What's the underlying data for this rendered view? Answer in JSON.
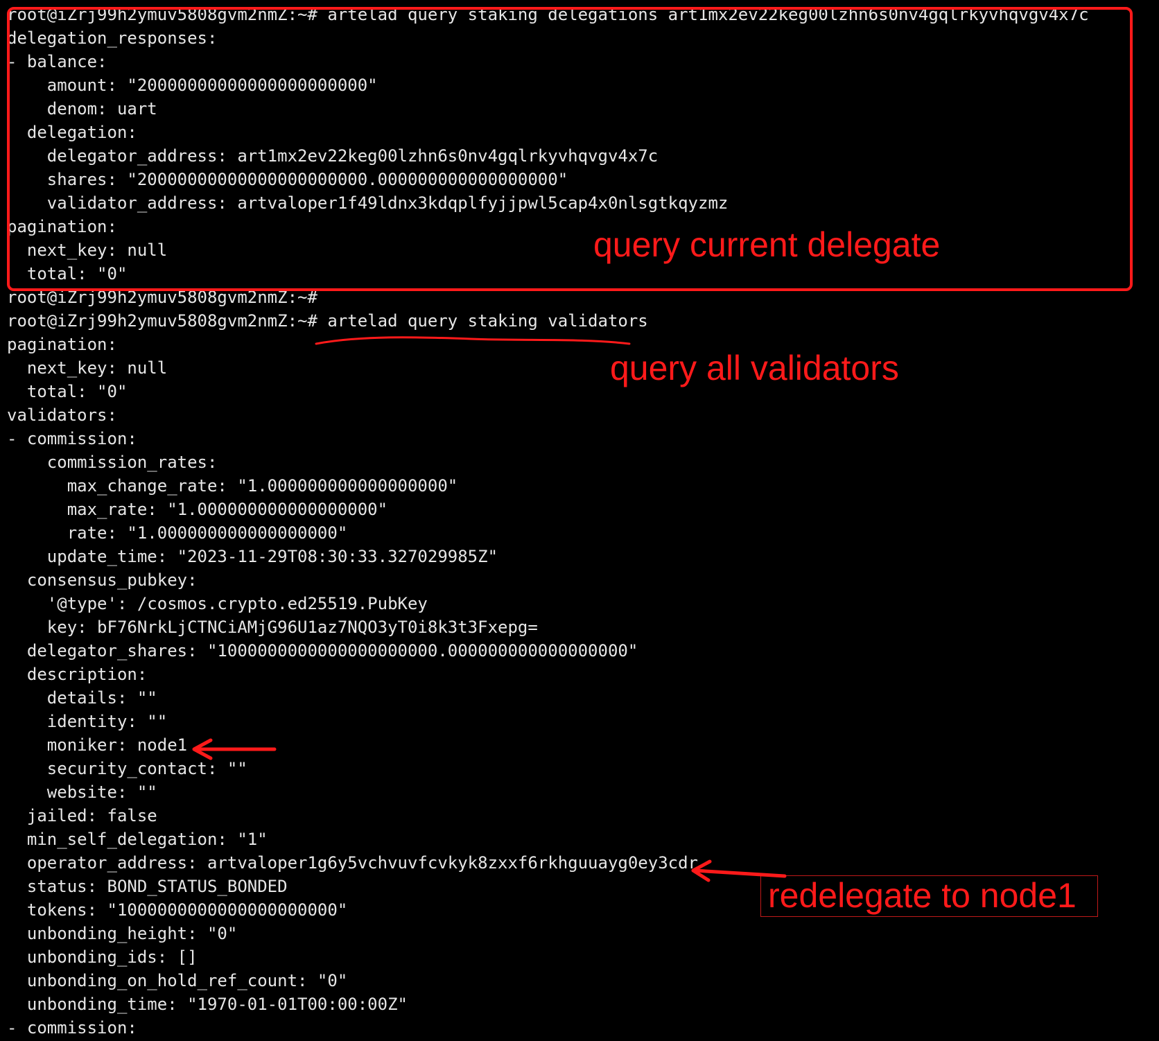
{
  "terminal": {
    "lines": [
      "root@iZrj99h2ymuv5808gvm2nmZ:~# artelad query staking delegations art1mx2ev22keg00lzhn6s0nv4gqlrkyvhqvgv4x7c",
      "delegation_responses:",
      "- balance:",
      "    amount: \"20000000000000000000000\"",
      "    denom: uart",
      "  delegation:",
      "    delegator_address: art1mx2ev22keg00lzhn6s0nv4gqlrkyvhqvgv4x7c",
      "    shares: \"20000000000000000000000.000000000000000000\"",
      "    validator_address: artvaloper1f49ldnx3kdqplfyjjpwl5cap4x0nlsgtkqyzmz",
      "pagination:",
      "  next_key: null",
      "  total: \"0\"",
      "root@iZrj99h2ymuv5808gvm2nmZ:~#",
      "root@iZrj99h2ymuv5808gvm2nmZ:~# artelad query staking validators",
      "pagination:",
      "  next_key: null",
      "  total: \"0\"",
      "validators:",
      "- commission:",
      "    commission_rates:",
      "      max_change_rate: \"1.000000000000000000\"",
      "      max_rate: \"1.000000000000000000\"",
      "      rate: \"1.000000000000000000\"",
      "    update_time: \"2023-11-29T08:30:33.327029985Z\"",
      "  consensus_pubkey:",
      "    '@type': /cosmos.crypto.ed25519.PubKey",
      "    key: bF76NrkLjCTNCiAMjG96U1az7NQO3yT0i8k3t3Fxepg=",
      "  delegator_shares: \"1000000000000000000000.000000000000000000\"",
      "  description:",
      "    details: \"\"",
      "    identity: \"\"",
      "    moniker: node1",
      "    security_contact: \"\"",
      "    website: \"\"",
      "  jailed: false",
      "  min_self_delegation: \"1\"",
      "  operator_address: artvaloper1g6y5vchvuvfcvkyk8zxxf6rkhguuayg0ey3cdr",
      "  status: BOND_STATUS_BONDED",
      "  tokens: \"1000000000000000000000\"",
      "  unbonding_height: \"0\"",
      "  unbonding_ids: []",
      "  unbonding_on_hold_ref_count: \"0\"",
      "  unbonding_time: \"1970-01-01T00:00:00Z\"",
      "- commission:"
    ]
  },
  "annotations": {
    "current_delegate": "query current delegate",
    "all_validators": "query all validators",
    "redelegate": "redelegate to node1"
  },
  "colors": {
    "background": "#000000",
    "text": "#e6e6e6",
    "annotation": "#ff1a1a"
  }
}
